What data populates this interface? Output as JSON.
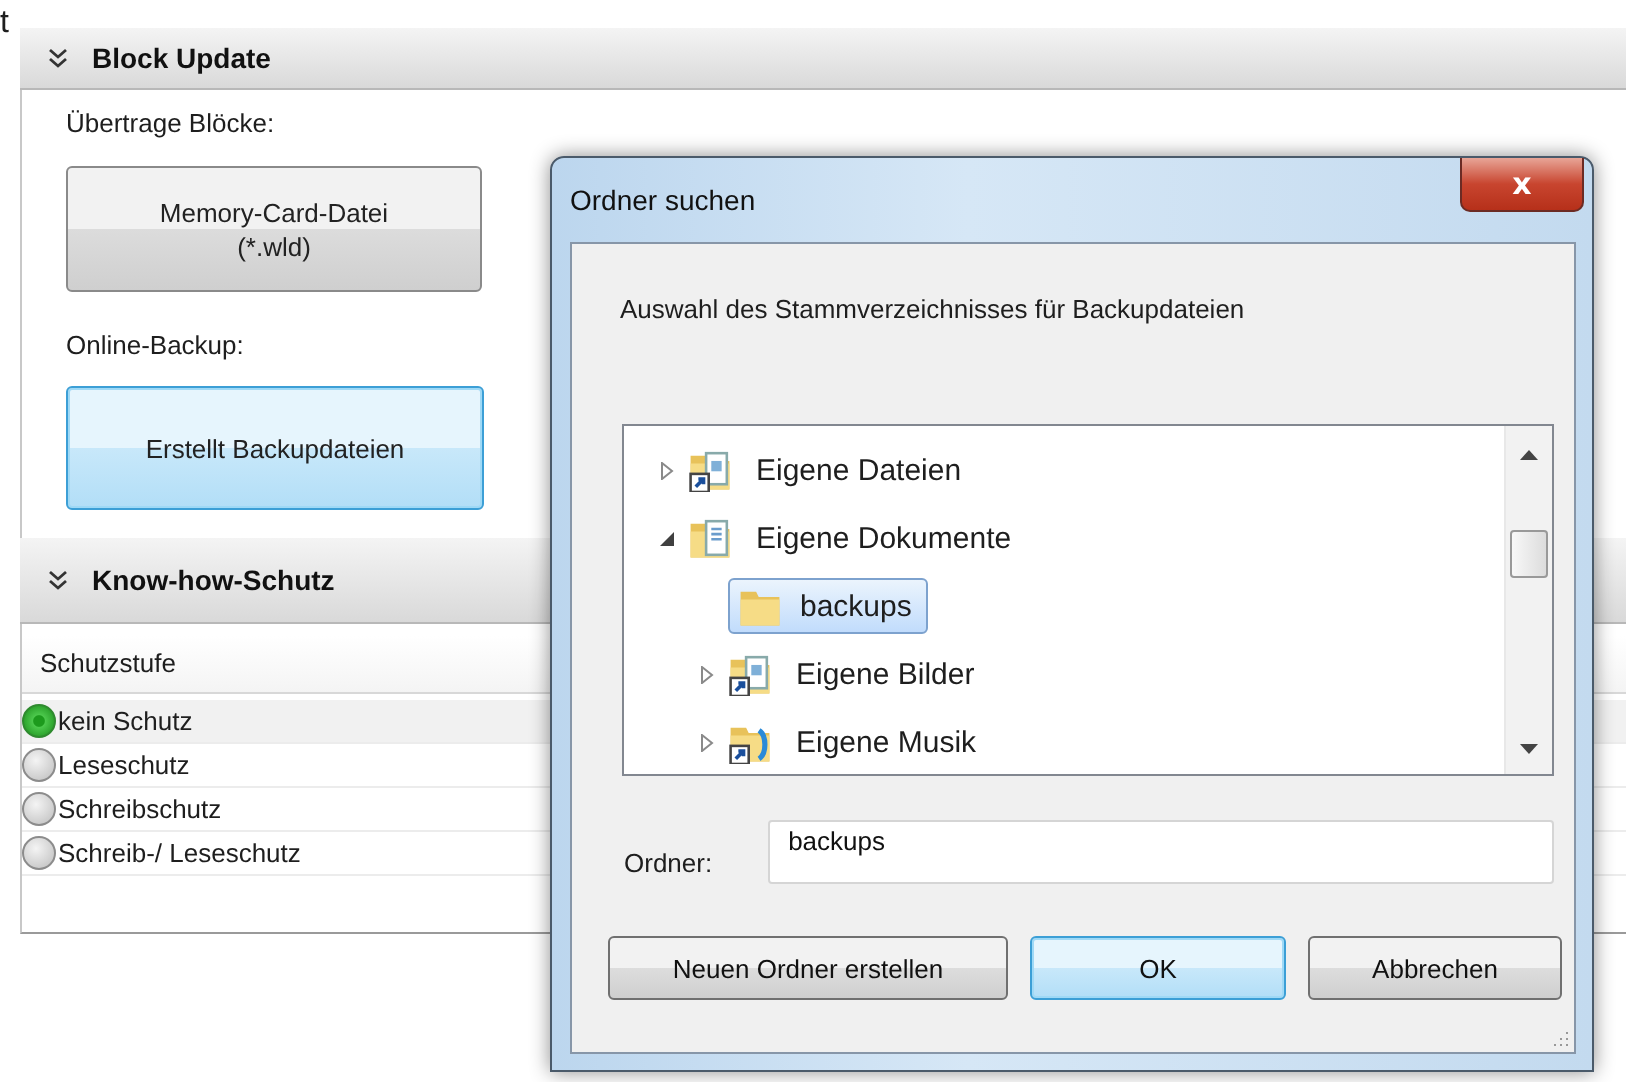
{
  "corner_text": "t",
  "block_update": {
    "title": "Block Update",
    "expanded": true,
    "transfer_label": "Übertrage Blöcke:",
    "memory_card_button": {
      "label": "Memory-Card-Datei\n(*.wld)",
      "highlighted": false
    },
    "online_label": "Online-Backup:",
    "backup_button": {
      "label": "Erstellt Backupdateien",
      "highlighted": true
    }
  },
  "knowhow": {
    "title": "Know-how-Schutz",
    "expanded": true,
    "column_header": "Schutzstufe",
    "options": [
      {
        "label": "kein Schutz",
        "selected": true
      },
      {
        "label": "Leseschutz",
        "selected": false
      },
      {
        "label": "Schreibschutz",
        "selected": false
      },
      {
        "label": "Schreib-/ Leseschutz",
        "selected": false
      }
    ]
  },
  "dialog": {
    "title": "Ordner suchen",
    "close": "x",
    "description": "Auswahl des Stammverzeichnisses für Backupdateien",
    "tree": [
      {
        "label": "Eigene Dateien",
        "kind": "shortcut",
        "expandable": true,
        "expanded": false,
        "selected": false
      },
      {
        "label": "Eigene Dokumente",
        "kind": "library",
        "expandable": true,
        "expanded": true,
        "selected": false,
        "children": [
          {
            "label": "backups",
            "kind": "folder",
            "expandable": false,
            "selected": true
          },
          {
            "label": "Eigene Bilder",
            "kind": "shortcut",
            "expandable": true,
            "expanded": false,
            "selected": false
          },
          {
            "label": "Eigene Musik",
            "kind": "music",
            "expandable": true,
            "expanded": false,
            "selected": false
          }
        ]
      }
    ],
    "folder_label": "Ordner:",
    "folder_value": "backups",
    "buttons": [
      {
        "label": "Neuen Ordner erstellen",
        "default": false
      },
      {
        "label": "OK",
        "default": true
      },
      {
        "label": "Abbrechen",
        "default": false
      }
    ]
  }
}
